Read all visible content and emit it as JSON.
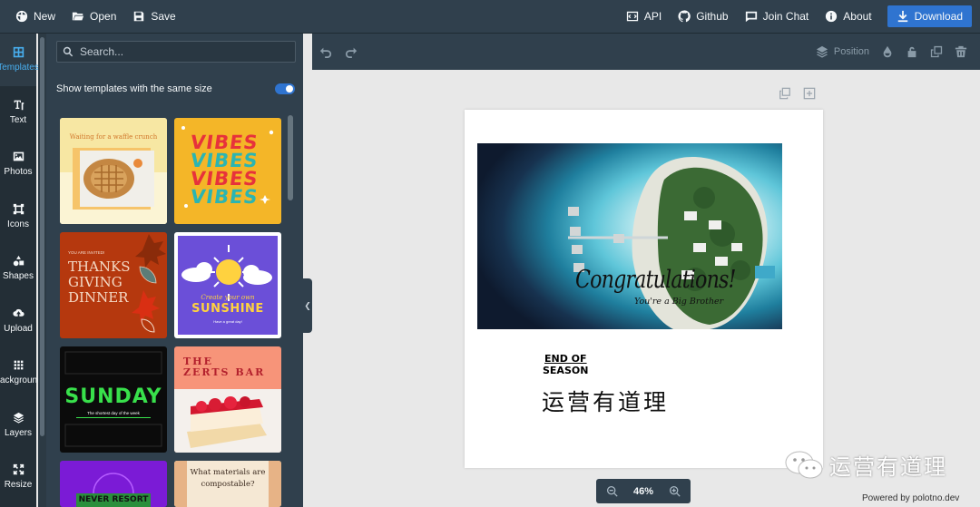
{
  "topbar": {
    "new_label": "New",
    "open_label": "Open",
    "save_label": "Save",
    "api_label": "API",
    "github_label": "Github",
    "chat_label": "Join Chat",
    "about_label": "About",
    "download_label": "Download"
  },
  "rail": {
    "items": [
      {
        "label": "Templates",
        "icon": "templates-icon"
      },
      {
        "label": "Text",
        "icon": "text-icon"
      },
      {
        "label": "Photos",
        "icon": "photos-icon"
      },
      {
        "label": "Icons",
        "icon": "icons-icon"
      },
      {
        "label": "Shapes",
        "icon": "shapes-icon"
      },
      {
        "label": "Upload",
        "icon": "upload-icon"
      },
      {
        "label": "Background",
        "icon": "background-icon"
      },
      {
        "label": "Layers",
        "icon": "layers-icon"
      },
      {
        "label": "Resize",
        "icon": "resize-icon"
      }
    ]
  },
  "panel": {
    "search_placeholder": "Search...",
    "same_size_label": "Show templates with the same size",
    "same_size_on": true,
    "templates": {
      "waffle": "Waiting for a waffle crunch",
      "vibes": "VIBES",
      "thanks_small": "YOU ARE INVITED!",
      "thanks_line1": "THANKS",
      "thanks_line2": "GIVING",
      "thanks_line3": "DINNER",
      "sunshine_small": "Create your own",
      "sunshine": "SUNSHINE",
      "sunshine_tag": "Have a great day!",
      "sunday": "SUNDAY",
      "sunday_sub": "The shortest day of the week",
      "zerts_line1": "THE",
      "zerts_line2": "ZERTS BAR",
      "materials_line1": "What materials are",
      "materials_line2": "compostable?",
      "resort": "NEVER RESORT"
    }
  },
  "toolbar": {
    "position_label": "Position"
  },
  "canvas": {
    "congrats": "Congratulations!",
    "brother": "You're a Big Brother",
    "end_line1": "END OF",
    "end_line2": "SEASON",
    "chinese_text": "运营有道理"
  },
  "zoom": {
    "value": "46%"
  },
  "watermark": {
    "text": "运营有道理"
  },
  "footer": {
    "powered": "Powered by polotno.dev"
  },
  "colors": {
    "accent": "#2f74d0",
    "topbar": "#30404d",
    "rail": "#232e36",
    "active": "#48aff0"
  }
}
